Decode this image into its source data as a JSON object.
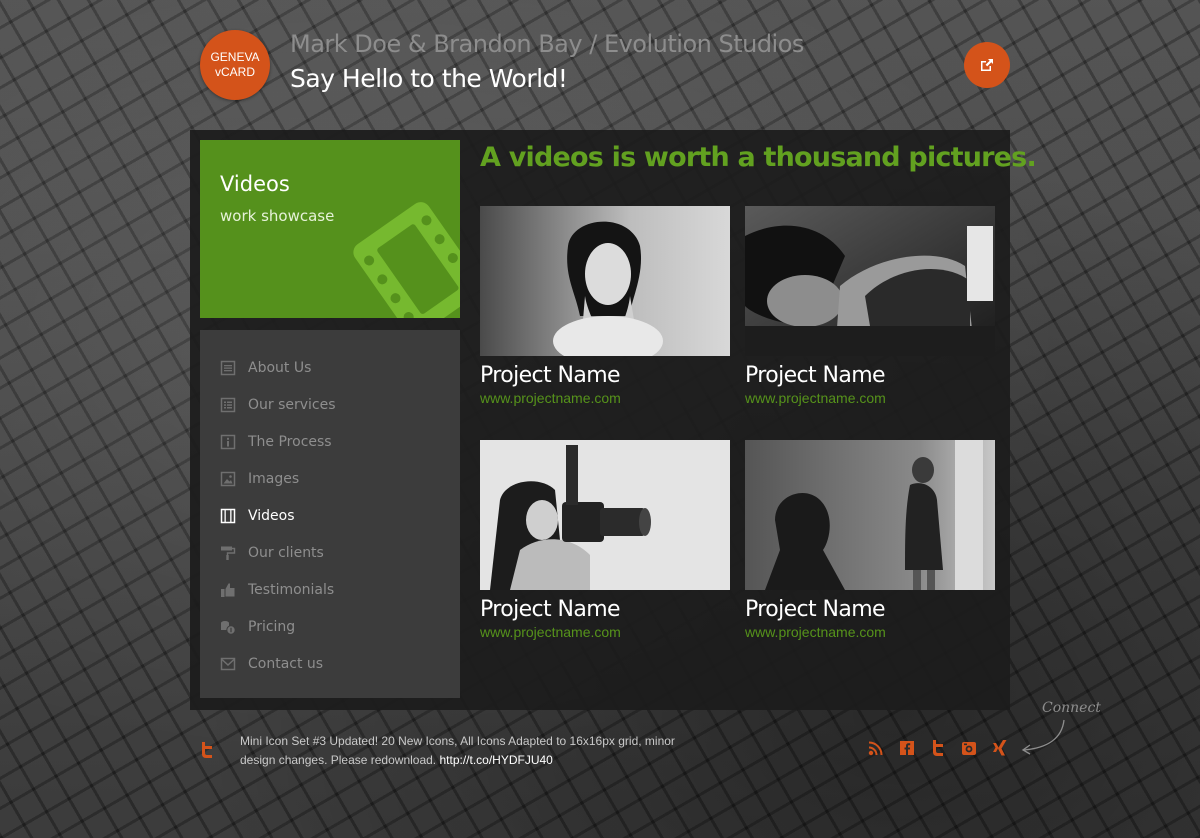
{
  "header": {
    "badge": [
      "GENEVA",
      "vCARD"
    ],
    "title": "Mark Doe & Brandon Bay / Evolution Studios",
    "tagline": "Say Hello to the World!",
    "external_icon": "external-link-icon"
  },
  "section": {
    "title": "Videos",
    "subtitle": "work showcase",
    "icon": "film-strip-icon",
    "color": "#55911c"
  },
  "nav": [
    {
      "label": "About Us",
      "icon": "document-icon",
      "active": false
    },
    {
      "label": "Our services",
      "icon": "list-icon",
      "active": false
    },
    {
      "label": "The Process",
      "icon": "info-icon",
      "active": false
    },
    {
      "label": "Images",
      "icon": "image-icon",
      "active": false
    },
    {
      "label": "Videos",
      "icon": "film-icon",
      "active": true
    },
    {
      "label": "Our clients",
      "icon": "roller-icon",
      "active": false
    },
    {
      "label": "Testimonials",
      "icon": "thumbs-up-icon",
      "active": false
    },
    {
      "label": "Pricing",
      "icon": "coins-icon",
      "active": false
    },
    {
      "label": "Contact us",
      "icon": "mail-icon",
      "active": false
    }
  ],
  "main": {
    "headline": "A videos is worth a thousand pictures.",
    "projects": [
      {
        "name": "Project Name",
        "link": "www.projectname.com"
      },
      {
        "name": "Project Name",
        "link": "www.projectname.com"
      },
      {
        "name": "Project Name",
        "link": "www.projectname.com"
      },
      {
        "name": "Project Name",
        "link": "www.projectname.com"
      }
    ]
  },
  "footer": {
    "tweet_text": "Mini Icon Set #3 Updated! 20 New Icons, All Icons Adapted to 16x16px grid, minor design changes. Please redownload.",
    "tweet_link": "http://t.co/HYDFJU40",
    "social": [
      "rss-icon",
      "facebook-icon",
      "twitter-icon",
      "flickr-icon",
      "xing-icon"
    ],
    "connect_label": "Connect"
  },
  "colors": {
    "accent_orange": "#d4531a",
    "accent_green": "#62a120",
    "panel_bg": "#1c1c1c",
    "nav_bg": "#3c3c3c"
  }
}
